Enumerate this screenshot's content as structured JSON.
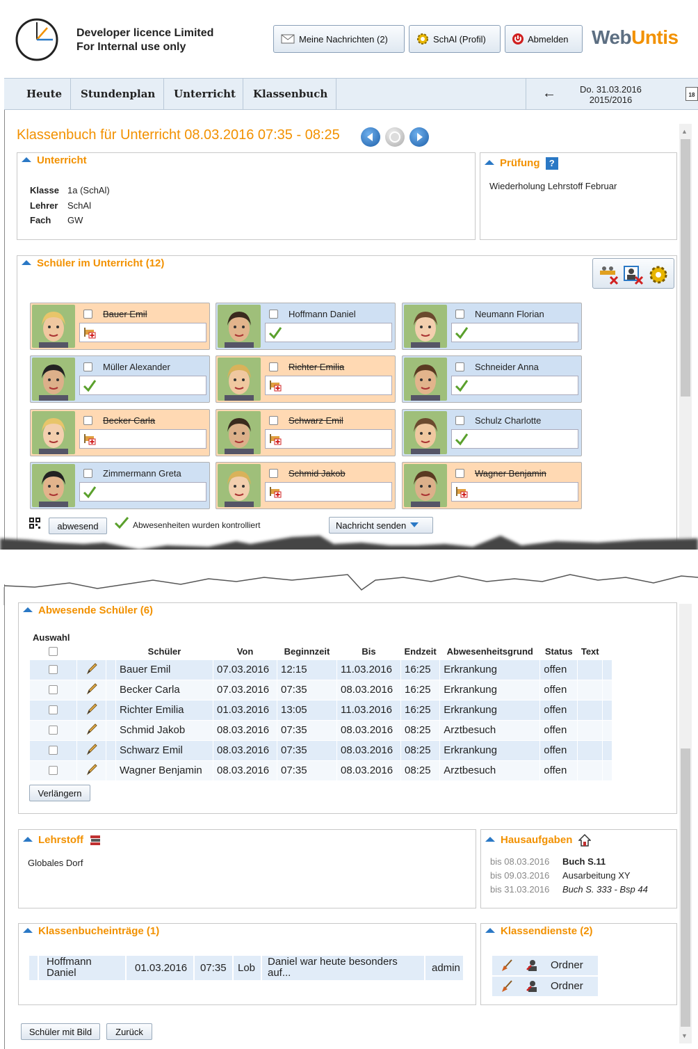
{
  "header": {
    "licence_line1": "Developer licence Limited",
    "licence_line2": "For Internal use only",
    "messages_label": "Meine Nachrichten (2)",
    "profile_label": "SchAl (Profil)",
    "logout_label": "Abmelden",
    "logo_web": "Web",
    "logo_untis": "Untis"
  },
  "nav": {
    "items": [
      "Heute",
      "Stundenplan",
      "Unterricht",
      "Klassenbuch"
    ],
    "date_line1": "Do. 31.03.2016",
    "date_line2": "2015/2016",
    "calendar_icon_text": "18"
  },
  "page": {
    "title": "Klassenbuch für Unterricht 08.03.2016 07:35 - 08:25"
  },
  "unterricht": {
    "title": "Unterricht",
    "klasse_label": "Klasse",
    "klasse_value": "1a (SchAl)",
    "lehrer_label": "Lehrer",
    "lehrer_value": "SchAl",
    "fach_label": "Fach",
    "fach_value": "GW"
  },
  "pruefung": {
    "title": "Prüfung",
    "help_icon_text": "?",
    "text": "Wiederholung Lehrstoff Februar"
  },
  "schueler": {
    "title": "Schüler im Unterricht (12)",
    "students": [
      {
        "name": "Bauer Emil",
        "absent": true
      },
      {
        "name": "Hoffmann Daniel",
        "absent": false
      },
      {
        "name": "Neumann Florian",
        "absent": false
      },
      {
        "name": "Müller Alexander",
        "absent": false
      },
      {
        "name": "Richter Emilia",
        "absent": true
      },
      {
        "name": "Schneider Anna",
        "absent": false
      },
      {
        "name": "Becker Carla",
        "absent": true
      },
      {
        "name": "Schwarz Emil",
        "absent": true
      },
      {
        "name": "Schulz Charlotte",
        "absent": false
      },
      {
        "name": "Zimmermann Greta",
        "absent": false
      },
      {
        "name": "Schmid Jakob",
        "absent": true
      },
      {
        "name": "Wagner Benjamin",
        "absent": true
      }
    ],
    "absent_button": "abwesend",
    "checked_text": "Abwesenheiten wurden kontrolliert",
    "message_button": "Nachricht senden"
  },
  "abwesende": {
    "title": "Abwesende Schüler (6)",
    "auswahl_label": "Auswahl",
    "columns": [
      "Schüler",
      "Von",
      "Beginnzeit",
      "Bis",
      "Endzeit",
      "Abwesenheitsgrund",
      "Status",
      "Text"
    ],
    "rows": [
      {
        "name": "Bauer Emil",
        "von": "07.03.2016",
        "begin": "12:15",
        "bis": "11.03.2016",
        "end": "16:25",
        "grund": "Erkrankung",
        "status": "offen"
      },
      {
        "name": "Becker Carla",
        "von": "07.03.2016",
        "begin": "07:35",
        "bis": "08.03.2016",
        "end": "16:25",
        "grund": "Erkrankung",
        "status": "offen"
      },
      {
        "name": "Richter Emilia",
        "von": "01.03.2016",
        "begin": "13:05",
        "bis": "11.03.2016",
        "end": "16:25",
        "grund": "Erkrankung",
        "status": "offen"
      },
      {
        "name": "Schmid Jakob",
        "von": "08.03.2016",
        "begin": "07:35",
        "bis": "08.03.2016",
        "end": "08:25",
        "grund": "Arztbesuch",
        "status": "offen"
      },
      {
        "name": "Schwarz Emil",
        "von": "08.03.2016",
        "begin": "07:35",
        "bis": "08.03.2016",
        "end": "08:25",
        "grund": "Erkrankung",
        "status": "offen"
      },
      {
        "name": "Wagner Benjamin",
        "von": "08.03.2016",
        "begin": "07:35",
        "bis": "08.03.2016",
        "end": "08:25",
        "grund": "Arztbesuch",
        "status": "offen"
      }
    ],
    "extend_button": "Verlängern"
  },
  "lehrstoff": {
    "title": "Lehrstoff",
    "text": "Globales Dorf"
  },
  "hausaufgaben": {
    "title": "Hausaufgaben",
    "items": [
      {
        "date": "bis 08.03.2016",
        "text": "Buch S.11"
      },
      {
        "date": "bis 09.03.2016",
        "text": "Ausarbeitung XY"
      },
      {
        "date": "bis 31.03.2016",
        "text": "Buch S. 333 - Bsp 44"
      }
    ]
  },
  "eintraege": {
    "title": "Klassenbucheinträge (1)",
    "row": {
      "name_line1": "Hoffmann",
      "name_line2": "Daniel",
      "date": "01.03.2016",
      "time": "07:35",
      "type": "Lob",
      "text_line1": "Daniel war heute besonders",
      "text_line2": "auf...",
      "user": "admin"
    }
  },
  "dienste": {
    "title": "Klassendienste (2)",
    "items": [
      "Ordner",
      "Ordner"
    ]
  },
  "footer": {
    "picture_button": "Schüler mit Bild",
    "back_button": "Zurück"
  },
  "colors": {
    "orange": "#f29100",
    "blue": "#2a78c5",
    "absent": "#ffd9b3",
    "present": "#cfe0f3"
  }
}
